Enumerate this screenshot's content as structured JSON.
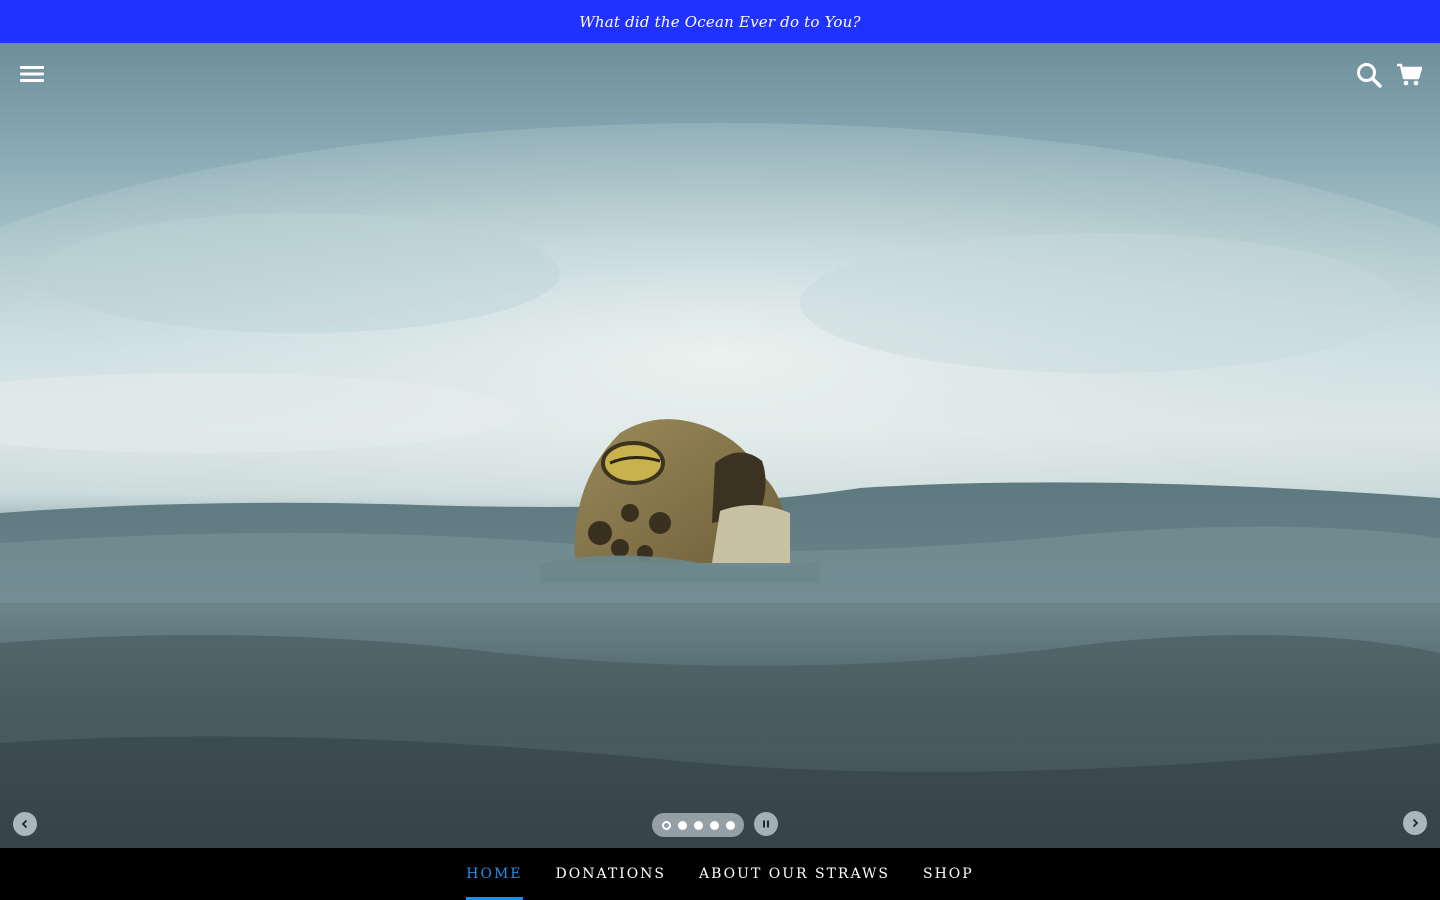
{
  "announcement": {
    "text": "What did the Ocean Ever do to You?",
    "background": "#1f32ff",
    "text_color": "#ffffff"
  },
  "header": {
    "menu_icon": "hamburger-menu-icon",
    "search_icon": "search-icon",
    "cart_icon": "cart-icon"
  },
  "hero": {
    "image_subject": "sea turtle head above ocean surface",
    "slideshow": {
      "slide_count": 5,
      "active_slide": 1,
      "prev_icon": "chevron-left-icon",
      "next_icon": "chevron-right-icon",
      "pause_icon": "pause-icon"
    }
  },
  "nav": {
    "items": [
      {
        "label": "HOME",
        "active": true
      },
      {
        "label": "DONATIONS",
        "active": false
      },
      {
        "label": "ABOUT OUR STRAWS",
        "active": false
      },
      {
        "label": "SHOP",
        "active": false
      }
    ],
    "active_color": "#1e90e8",
    "background": "#000000"
  }
}
